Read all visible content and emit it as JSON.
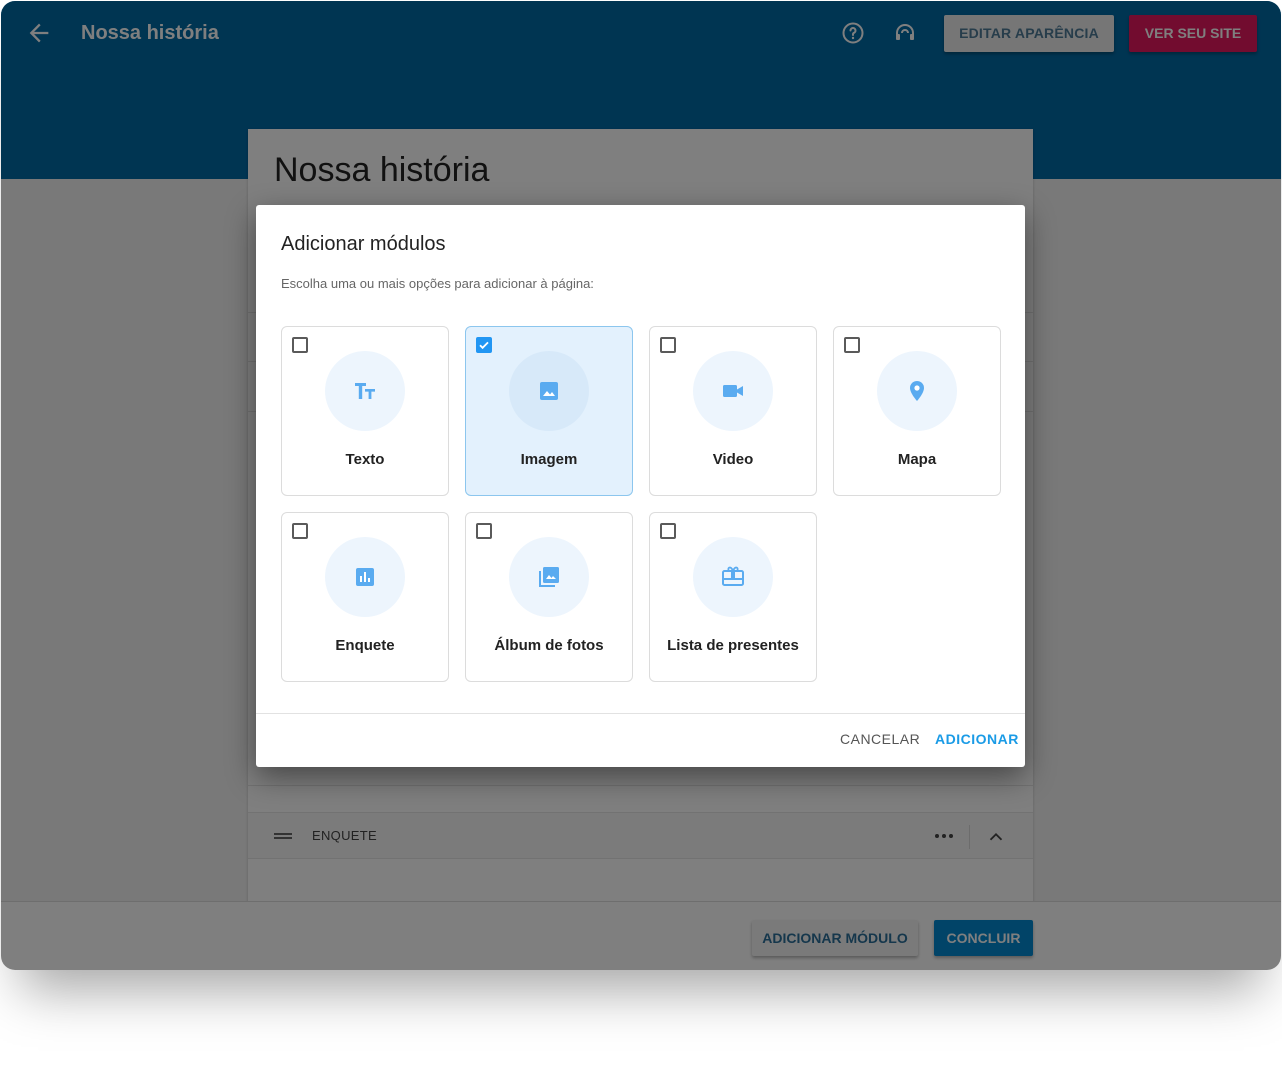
{
  "header": {
    "title": "Nossa história",
    "edit_appearance_label": "EDITAR APARÊNCIA",
    "view_site_label": "VER SEU SITE",
    "icons": [
      "back-arrow-icon",
      "help-icon",
      "support-headset-icon"
    ]
  },
  "page": {
    "title": "Nossa história",
    "module_row": {
      "label": "ENQUETE"
    }
  },
  "footer": {
    "add_module_label": "ADICIONAR MÓDULO",
    "done_label": "CONCLUIR"
  },
  "dialog": {
    "title": "Adicionar módulos",
    "subtitle": "Escolha uma ou mais opções para adicionar à página:",
    "options": [
      {
        "label": "Texto",
        "icon": "text-format-icon",
        "checked": false
      },
      {
        "label": "Imagem",
        "icon": "image-icon",
        "checked": true
      },
      {
        "label": "Video",
        "icon": "video-camera-icon",
        "checked": false
      },
      {
        "label": "Mapa",
        "icon": "map-pin-icon",
        "checked": false
      },
      {
        "label": "Enquete",
        "icon": "poll-icon",
        "checked": false
      },
      {
        "label": "Álbum de fotos",
        "icon": "photo-library-icon",
        "checked": false
      },
      {
        "label": "Lista de presentes",
        "icon": "gift-card-icon",
        "checked": false
      }
    ],
    "cancel_label": "CANCELAR",
    "add_label": "ADICIONAR"
  },
  "colors": {
    "header_blue": "#016aa5",
    "accent_pink": "#e5195e",
    "primary_blue": "#0288d1",
    "icon_blue": "#5aabf0",
    "selected_tile": "#e3f1fd"
  }
}
